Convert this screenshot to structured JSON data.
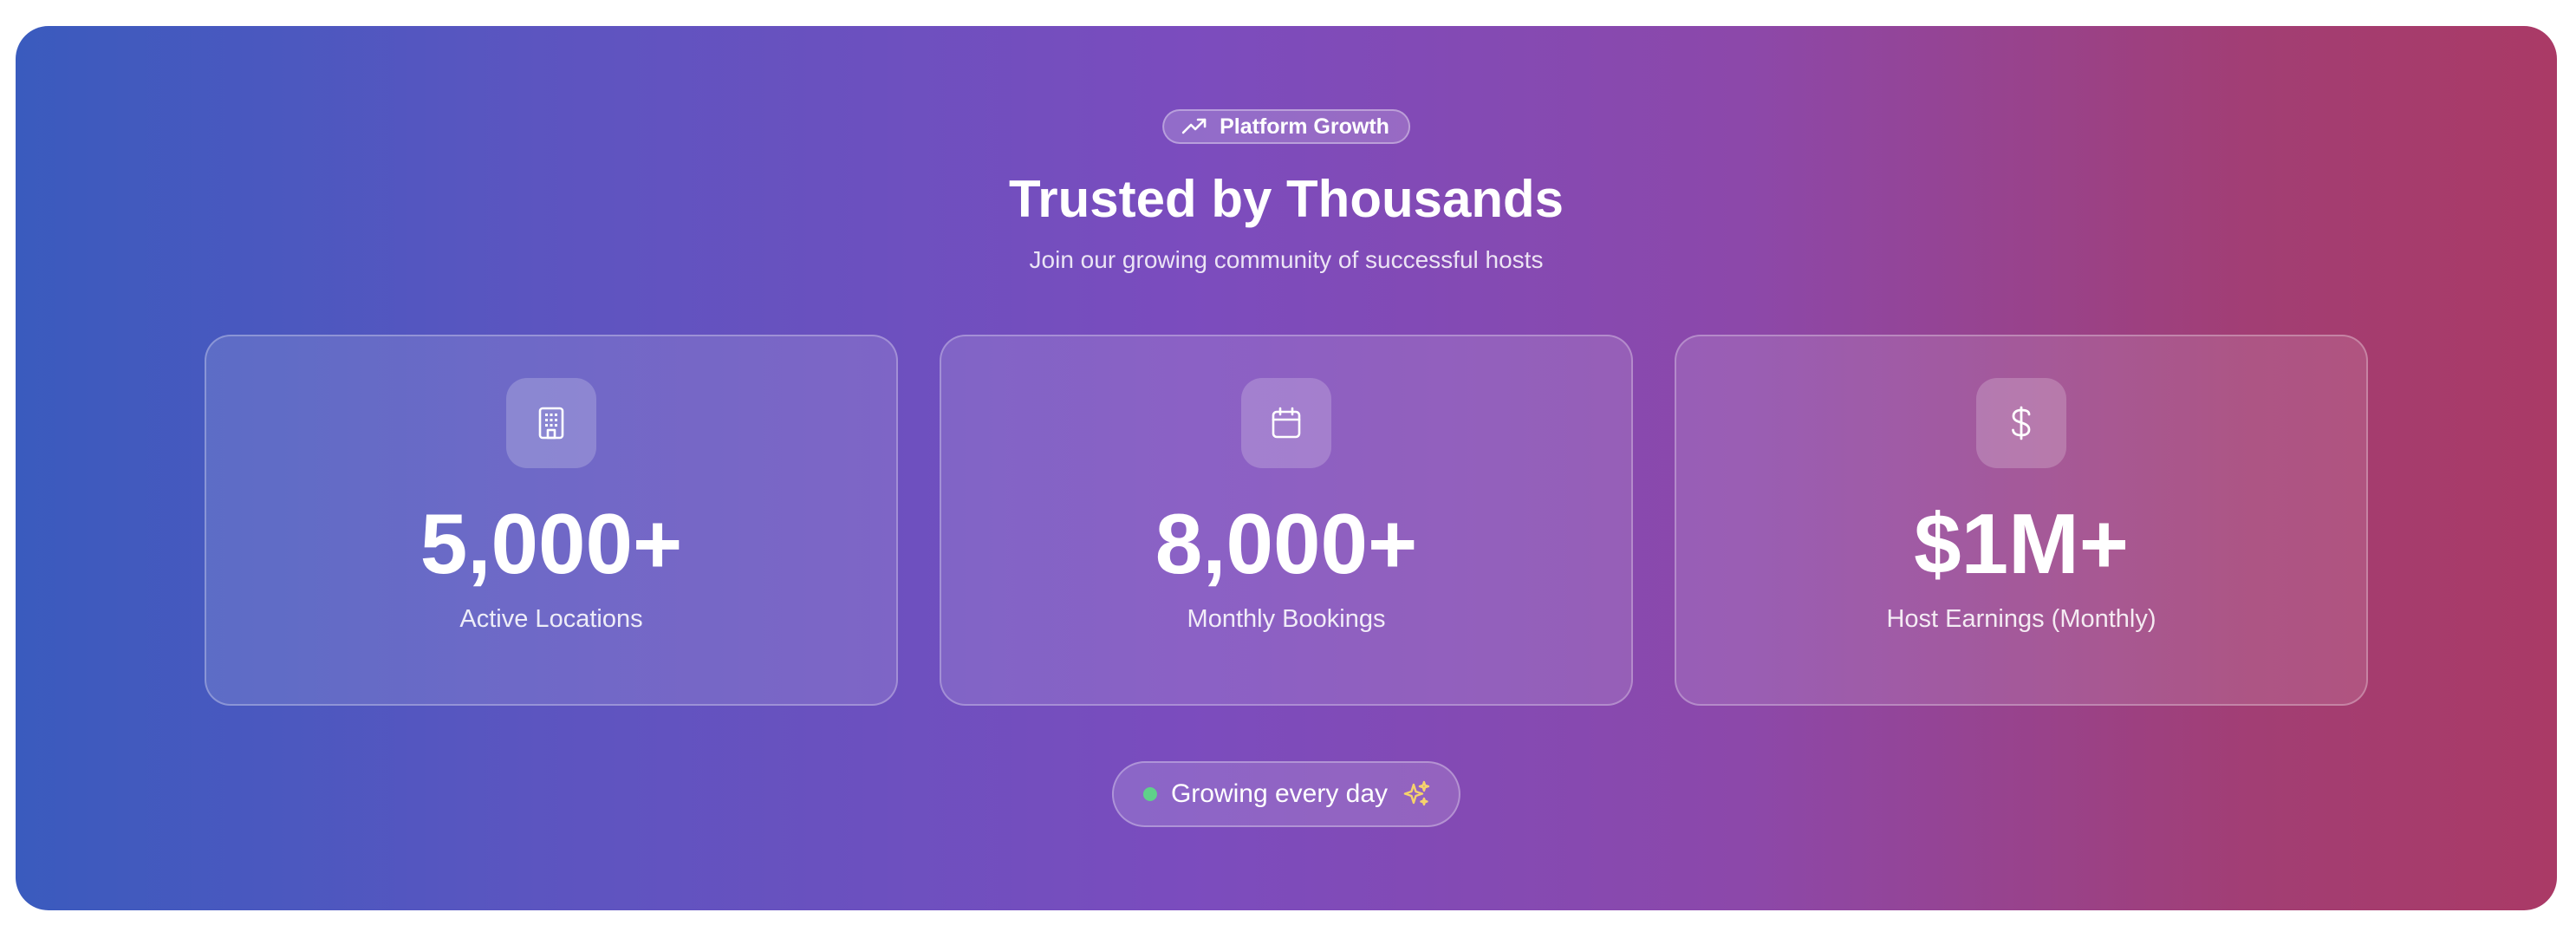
{
  "badge": {
    "label": "Platform Growth",
    "icon": "trending-up-icon"
  },
  "header": {
    "title": "Trusted by Thousands",
    "subtitle": "Join our growing community of successful hosts"
  },
  "stats": [
    {
      "icon": "building-icon",
      "value": "5,000+",
      "label": "Active Locations"
    },
    {
      "icon": "calendar-icon",
      "value": "8,000+",
      "label": "Monthly Bookings"
    },
    {
      "icon": "dollar-icon",
      "value": "$1M+",
      "label": "Host Earnings (Monthly)"
    }
  ],
  "footer_pill": {
    "label": "Growing every day",
    "icon": "sparkles-icon",
    "status_color": "#5fd08a"
  },
  "colors": {
    "gradient_start": "#3a5bbe",
    "gradient_mid": "#7b4cbe",
    "gradient_end": "#aa3a66"
  }
}
